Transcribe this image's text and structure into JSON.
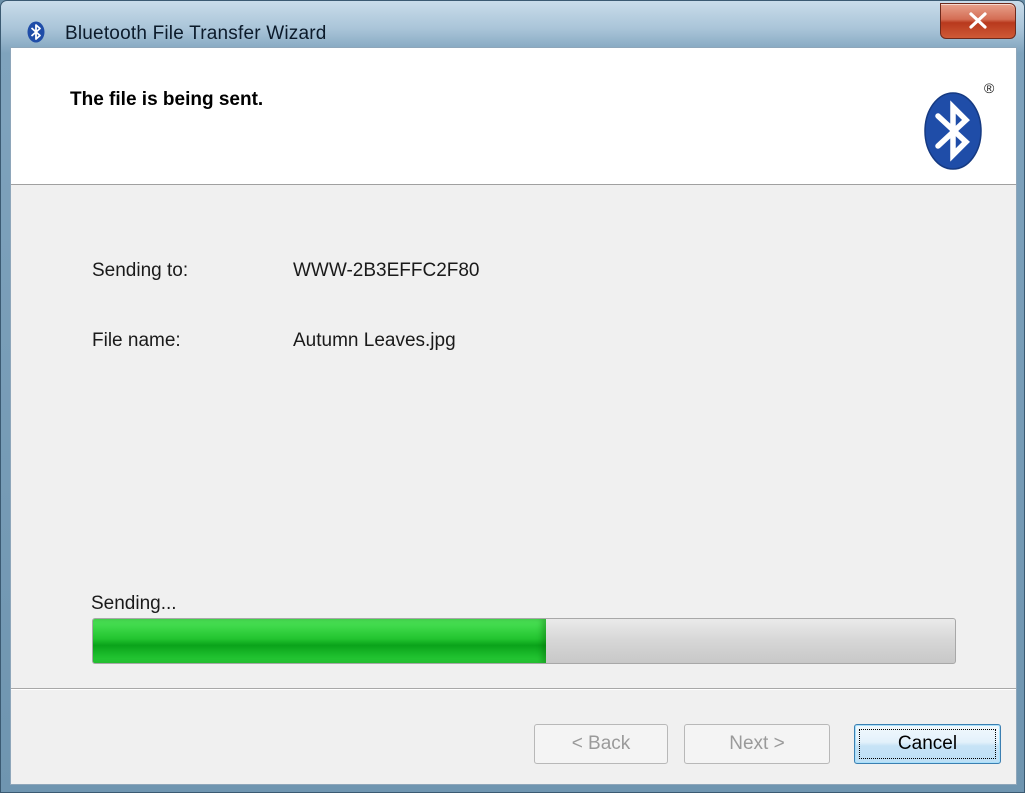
{
  "window": {
    "title": "Bluetooth File Transfer Wizard",
    "title_icon": "bluetooth-icon",
    "close_icon": "close-x-icon"
  },
  "header": {
    "title": "The file is being sent.",
    "logo": "bluetooth-logo",
    "logo_mark": "®"
  },
  "details": {
    "sending_to_label": "Sending to:",
    "sending_to_value": "WWW-2B3EFFC2F80",
    "file_name_label": "File name:",
    "file_name_value": "Autumn Leaves.jpg"
  },
  "progress": {
    "status": "Sending...",
    "fraction": 0.525,
    "fill_color": "#1fbf2c"
  },
  "buttons": {
    "back_label": "< Back",
    "next_label": "Next >",
    "cancel_label": "Cancel"
  },
  "colors": {
    "close_button": "#c9462a",
    "bluetooth_blue": "#1f4da8"
  }
}
